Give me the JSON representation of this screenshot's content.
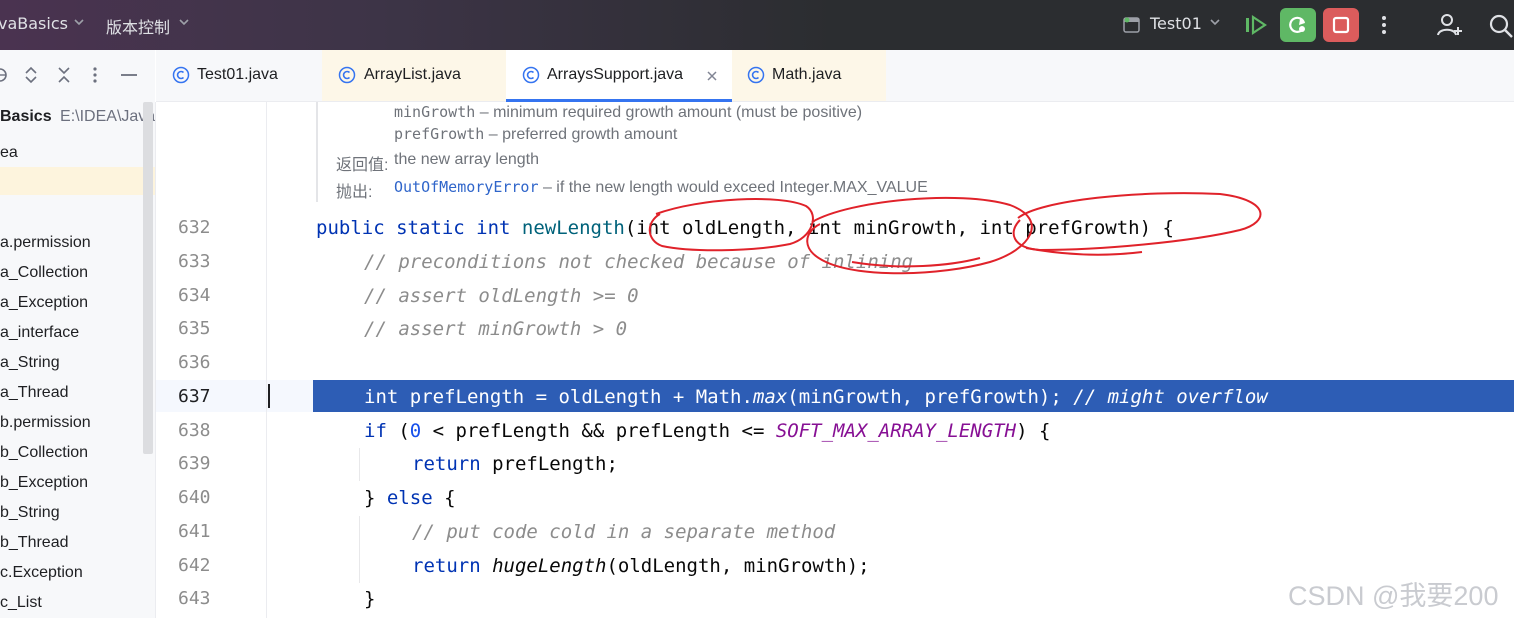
{
  "topbar": {
    "project": "vaBasics",
    "vcs": "版本控制",
    "run_config": "Test01"
  },
  "sidebar": {
    "project_name": "Basics",
    "project_path": "E:\\IDEA\\Java",
    "items": [
      {
        "label": "ea"
      },
      {
        "label": ""
      },
      {
        "label": ""
      },
      {
        "label": "a.permission"
      },
      {
        "label": "a_Collection"
      },
      {
        "label": "a_Exception"
      },
      {
        "label": "a_interface"
      },
      {
        "label": "a_String"
      },
      {
        "label": "a_Thread"
      },
      {
        "label": "b.permission"
      },
      {
        "label": "b_Collection"
      },
      {
        "label": "b_Exception"
      },
      {
        "label": "b_String"
      },
      {
        "label": "b_Thread"
      },
      {
        "label": "c.Exception"
      },
      {
        "label": "c_List"
      }
    ]
  },
  "tabs": [
    {
      "label": "Test01.java",
      "active": false
    },
    {
      "label": "ArrayList.java",
      "active": false
    },
    {
      "label": "ArraysSupport.java",
      "active": true
    },
    {
      "label": "Math.java",
      "active": false
    }
  ],
  "doc": {
    "param1_name": "minGrowth",
    "param1_desc": " – minimum required growth amount (must be positive)",
    "param2_name": "prefGrowth",
    "param2_desc": " – preferred growth amount",
    "returns_label": "返回值:",
    "returns_text": "the new array length",
    "throws_label": "抛出:",
    "throws_class": "OutOfMemoryError",
    "throws_text": " – if the new length would exceed Integer.MAX_VALUE"
  },
  "code": {
    "line_numbers": [
      "632",
      "633",
      "634",
      "635",
      "636",
      "637",
      "638",
      "639",
      "640",
      "641",
      "642",
      "643"
    ],
    "l632": {
      "kw": "public static int ",
      "fn": "newLength",
      "rest": "(int oldLength, int minGrowth, int prefGrowth) {"
    },
    "l633": "// preconditions not checked because of inlining",
    "l634": "// assert oldLength >= 0",
    "l635": "// assert minGrowth > 0",
    "l637": {
      "kw": "int",
      "mid": " prefLength = oldLength + Math.",
      "it": "max",
      "rest": "(minGrowth, prefGrowth); ",
      "cm": "// might overflow"
    },
    "l638": {
      "kw": "if",
      "a": " (",
      "num": "0",
      "b": " < prefLength && prefLength <= ",
      "const": "SOFT_MAX_ARRAY_LENGTH",
      "c": ") {"
    },
    "l639": {
      "kw": "return",
      "rest": " prefLength;"
    },
    "l640": {
      "a": "} ",
      "kw": "else",
      "b": " {"
    },
    "l641": "// put code cold in a separate method",
    "l642": {
      "kw": "return",
      "a": " ",
      "it": "hugeLength",
      "rest": "(oldLength, minGrowth);"
    },
    "l643": "}"
  },
  "watermark": "CSDN @我要200",
  "colors": {
    "selection": "#2d5db5",
    "keyword": "#0033b3",
    "comment": "#8c8c8c",
    "annotation": "#e0222a",
    "run_green": "#5fb865",
    "stop_red": "#db5c5c"
  }
}
